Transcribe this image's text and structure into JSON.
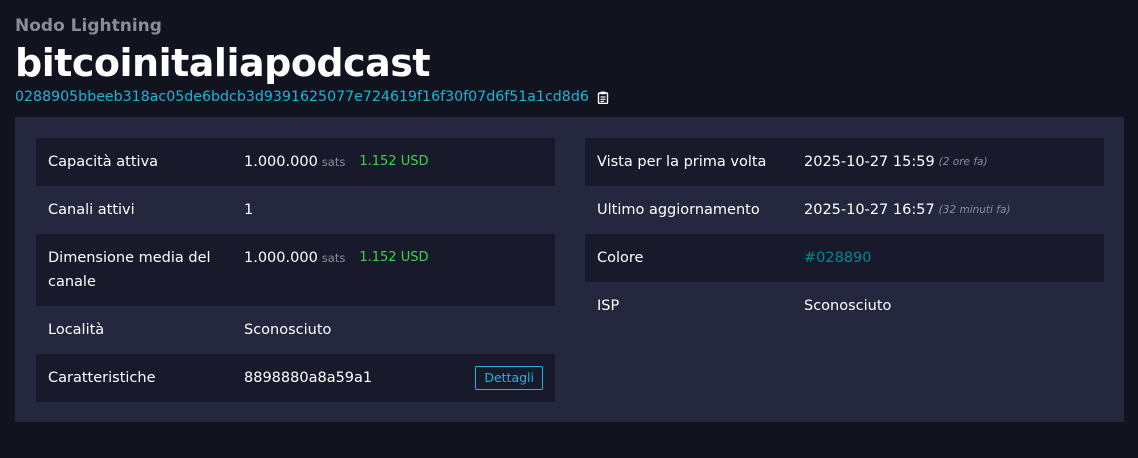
{
  "header": {
    "subtitle": "Nodo Lightning",
    "title": "bitcoinitaliapodcast",
    "pubkey": "0288905bbeeb318ac05de6bdcb3d9391625077e724619f16f30f07d6f51a1cd8d6"
  },
  "left": {
    "active_capacity": {
      "label": "Capacità attiva",
      "value": "1.000.000",
      "unit": "sats",
      "usd": "1.152 USD"
    },
    "active_channels": {
      "label": "Canali attivi",
      "value": "1"
    },
    "avg_channel_size": {
      "label": "Dimensione media del canale",
      "value": "1.000.000",
      "unit": "sats",
      "usd": "1.152 USD"
    },
    "location": {
      "label": "Località",
      "value": "Sconosciuto"
    },
    "features": {
      "label": "Caratteristiche",
      "value": "8898880a8a59a1",
      "button": "Dettagli"
    }
  },
  "right": {
    "first_seen": {
      "label": "Vista per la prima volta",
      "value": "2025-10-27 15:59",
      "ago": "(2 ore fa)"
    },
    "last_update": {
      "label": "Ultimo aggiornamento",
      "value": "2025-10-27 16:57",
      "ago": "(32 minuti fa)"
    },
    "color": {
      "label": "Colore",
      "value": "#028890"
    },
    "isp": {
      "label": "ISP",
      "value": "Sconosciuto"
    }
  },
  "icons": {
    "copy": "clipboard-icon"
  },
  "colors": {
    "background": "#11131f",
    "box": "#24273e",
    "row_dark": "#181a2c",
    "link": "#1bb6d8",
    "usd": "#3bd44a",
    "node_color": "#028890"
  }
}
